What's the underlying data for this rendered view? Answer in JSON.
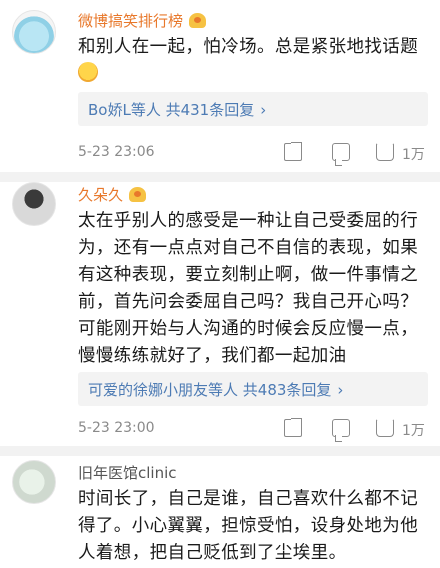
{
  "comments": [
    {
      "user": "微博搞笑排行榜",
      "text": "和别人在一起，怕冷场。总是紧张地找话题",
      "replies": "Bo娇L等人 共431条回复",
      "time": "5-23 23:06",
      "likes": "1万"
    },
    {
      "user": "久朵久",
      "text": "太在乎别人的感受是一种让自己受委屈的行为，还有一点点对自己不自信的表现，如果有这种表现，要立刻制止啊，做一件事情之前，首先问会委屈自己吗？我自己开心吗？可能刚开始与人沟通的时候会反应慢一点，慢慢练练就好了，我们都一起加油",
      "replies": "可爱的徐娜小朋友等人 共483条回复",
      "time": "5-23 23:00",
      "likes": "1万"
    },
    {
      "user": "旧年医馆clinic",
      "text": "时间长了，自己是谁，自己喜欢什么都不记得了。小心翼翼，担惊受怕，设身处地为他人着想，把自己贬低到了尘埃里。"
    }
  ],
  "icons": {
    "crown": "vip-crown-icon",
    "share": "share-icon",
    "comment": "comment-icon",
    "like": "thumbs-up-icon",
    "arrow": "chevron-right-icon"
  }
}
